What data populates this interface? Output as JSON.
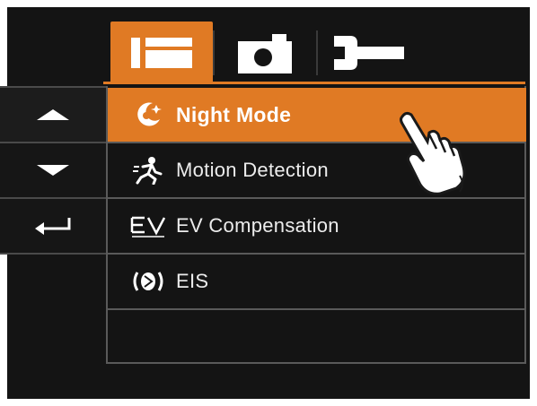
{
  "tabs": [
    {
      "name": "video-mode-tab",
      "icon": "video-camera-icon",
      "active": true
    },
    {
      "name": "photo-mode-tab",
      "icon": "camera-icon",
      "active": false
    },
    {
      "name": "setup-tab",
      "icon": "wrench-icon",
      "active": false
    }
  ],
  "nav": {
    "up_icon": "triangle-up-icon",
    "down_icon": "triangle-down-icon",
    "back_icon": "return-arrow-icon"
  },
  "menu": {
    "items": [
      {
        "label": "Night Mode",
        "icon": "night-mode-icon",
        "selected": true
      },
      {
        "label": "Motion Detection",
        "icon": "motion-detection-icon",
        "selected": false
      },
      {
        "label": "EV Compensation",
        "icon": "ev-compensation-icon",
        "selected": false
      },
      {
        "label": "EIS",
        "icon": "eis-icon",
        "selected": false
      }
    ]
  },
  "colors": {
    "accent": "#e07a24",
    "background": "#141414",
    "text": "#ececec"
  }
}
